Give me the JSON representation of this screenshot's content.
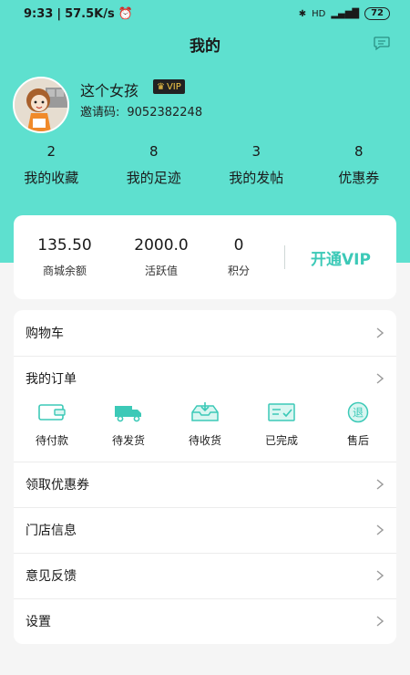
{
  "status_bar": {
    "time": "9:33",
    "speed": "57.5K/s",
    "battery": "72"
  },
  "header": {
    "title": "我的"
  },
  "profile": {
    "username": "这个女孩",
    "vip_label": "VIP",
    "invite_label": "邀请码:",
    "invite_code": "9052382248"
  },
  "stats": [
    {
      "count": "2",
      "label": "我的收藏"
    },
    {
      "count": "8",
      "label": "我的足迹"
    },
    {
      "count": "3",
      "label": "我的发帖"
    },
    {
      "count": "8",
      "label": "优惠券"
    }
  ],
  "wallet": {
    "balance": "135.50",
    "balance_label": "商城余额",
    "activity": "2000.0",
    "activity_label": "活跃值",
    "points": "0",
    "points_label": "积分",
    "open_vip": "开通VIP"
  },
  "menu": {
    "cart": "购物车",
    "orders": "我的订单",
    "order_status": [
      {
        "label": "待付款",
        "icon": "wallet-icon"
      },
      {
        "label": "待发货",
        "icon": "truck-icon"
      },
      {
        "label": "待收货",
        "icon": "inbox-icon"
      },
      {
        "label": "已完成",
        "icon": "done-icon"
      },
      {
        "label": "售后",
        "icon": "refund-icon"
      }
    ],
    "coupons": "领取优惠券",
    "store_info": "门店信息",
    "feedback": "意见反馈",
    "settings": "设置"
  },
  "colors": {
    "accent": "#5ee0cf",
    "accent_dark": "#3cc9b7"
  }
}
